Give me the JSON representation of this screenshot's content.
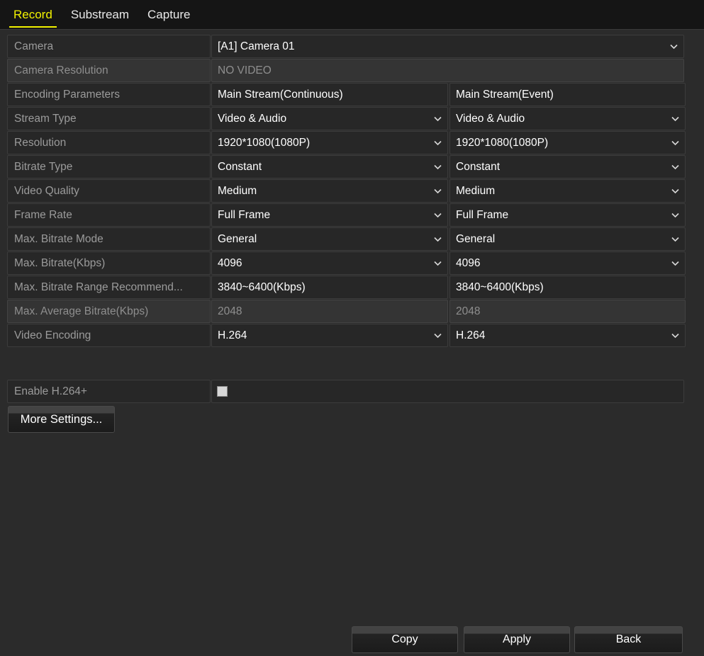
{
  "tabs": [
    {
      "label": "Record",
      "active": true
    },
    {
      "label": "Substream",
      "active": false
    },
    {
      "label": "Capture",
      "active": false
    }
  ],
  "colors": {
    "accent": "#f2f200",
    "page_background": "#2b2b2b",
    "tabbar_background": "#151515",
    "row_background": "#272727",
    "row_disabled_background": "#343434",
    "label_text": "#9b9b9b",
    "value_text": "#ffffff",
    "disabled_text": "#8e8e8e"
  },
  "settings": {
    "camera": {
      "label": "Camera",
      "value": "[A1] Camera 01",
      "control": "dropdown"
    },
    "camera_resolution": {
      "label": "Camera Resolution",
      "value": "NO VIDEO",
      "control": "readonly"
    },
    "encoding_parameters": {
      "label": "Encoding Parameters",
      "continuous": "Main Stream(Continuous)",
      "event": "Main Stream(Event)",
      "control": "header"
    },
    "rows": [
      {
        "label": "Stream Type",
        "continuous": "Video & Audio",
        "event": "Video & Audio",
        "control": "dropdown",
        "disabled": false
      },
      {
        "label": "Resolution",
        "continuous": "1920*1080(1080P)",
        "event": "1920*1080(1080P)",
        "control": "dropdown",
        "disabled": false
      },
      {
        "label": "Bitrate Type",
        "continuous": "Constant",
        "event": "Constant",
        "control": "dropdown",
        "disabled": false
      },
      {
        "label": "Video Quality",
        "continuous": "Medium",
        "event": "Medium",
        "control": "dropdown",
        "disabled": false
      },
      {
        "label": "Frame Rate",
        "continuous": "Full Frame",
        "event": "Full Frame",
        "control": "dropdown",
        "disabled": false
      },
      {
        "label": "Max. Bitrate Mode",
        "continuous": "General",
        "event": "General",
        "control": "dropdown",
        "disabled": false
      },
      {
        "label": "Max. Bitrate(Kbps)",
        "continuous": "4096",
        "event": "4096",
        "control": "dropdown",
        "disabled": false
      },
      {
        "label": "Max. Bitrate Range Recommend...",
        "continuous": "3840~6400(Kbps)",
        "event": "3840~6400(Kbps)",
        "control": "readonly",
        "disabled": false
      },
      {
        "label": "Max. Average Bitrate(Kbps)",
        "continuous": "2048",
        "event": "2048",
        "control": "readonly",
        "disabled": true
      },
      {
        "label": "Video Encoding",
        "continuous": "H.264",
        "event": "H.264",
        "control": "dropdown",
        "disabled": false
      }
    ],
    "enable_h264plus": {
      "label": "Enable H.264+",
      "checked": false
    },
    "more_settings_label": "More Settings..."
  },
  "footer": {
    "copy_label": "Copy",
    "apply_label": "Apply",
    "back_label": "Back"
  },
  "icons": {
    "chevron_down": "chevron-down-icon",
    "checkbox": "checkbox-icon"
  }
}
